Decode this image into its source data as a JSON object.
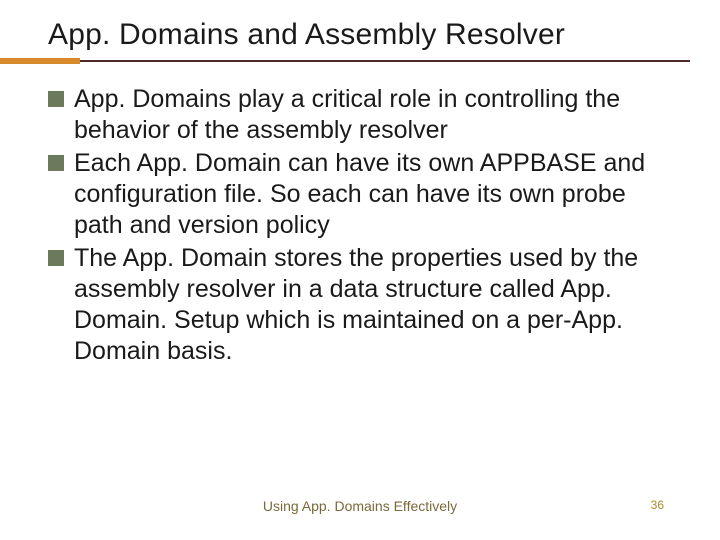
{
  "title": "App. Domains and Assembly Resolver",
  "bullets": [
    "App. Domains play a critical role in controlling the behavior of the assembly resolver",
    "Each App. Domain can have its own APPBASE and configuration file. So each can have its own probe path and version policy",
    "The App. Domain stores the properties used by the assembly resolver in a data structure called App. Domain. Setup which is maintained on a per-App. Domain basis."
  ],
  "footer": "Using App. Domains Effectively",
  "page_number": "36",
  "colors": {
    "bullet_marker": "#6a7a5a",
    "rule_accent": "#d88a2a",
    "rule_main": "#4a2a2a",
    "footer_text": "#7a6a3a",
    "pagenum": "#b08a2a"
  }
}
